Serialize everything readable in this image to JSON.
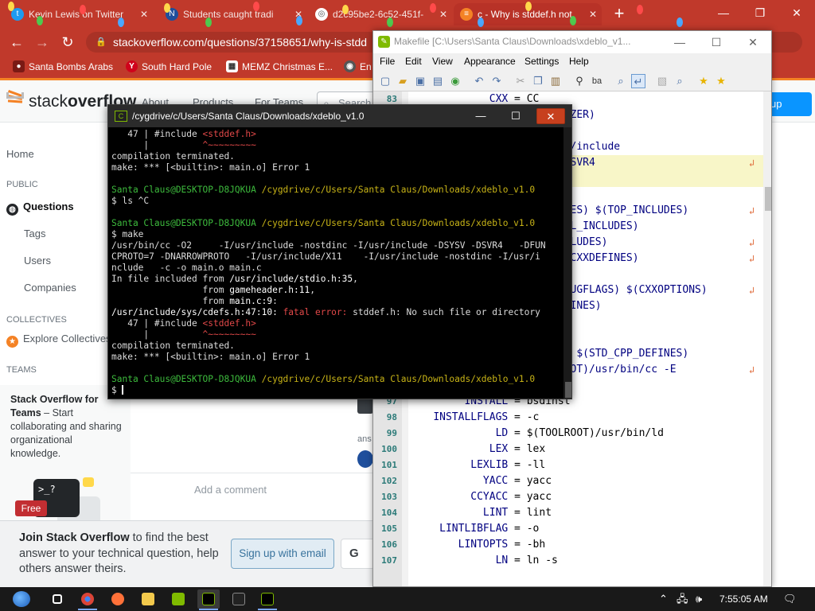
{
  "browser": {
    "tabs": [
      {
        "label": "Kevin Lewis on Twitter"
      },
      {
        "label": "Students caught tradi"
      },
      {
        "label": "d2c95be2-6c52-451f-"
      },
      {
        "label": "c - Why is stddef.h not"
      }
    ],
    "address": "stackoverflow.com/questions/37158651/why-is-stdd",
    "bookmarks": [
      {
        "label": "Santa Bombs Arabs"
      },
      {
        "label": "South Hard Pole"
      },
      {
        "label": "MEMZ Christmas E..."
      },
      {
        "label": "En"
      }
    ]
  },
  "so": {
    "logo_light": "stack",
    "logo_bold": "overflow",
    "nav": [
      "About",
      "Products",
      "For Teams"
    ],
    "search_placeholder": "Search",
    "signup": "up",
    "left_nav": {
      "home": "Home",
      "public": "PUBLIC",
      "questions": "Questions",
      "tags": "Tags",
      "users": "Users",
      "companies": "Companies",
      "collectives": "COLLECTIVES",
      "explore": "Explore Collectives",
      "teams": "TEAMS"
    },
    "teams_box": {
      "title": "Stack Overflow for Teams",
      "dash": " – ",
      "text": "Start collaborating and sharing organizational knowledge.",
      "badge": "Free",
      "art": ">_?"
    },
    "answer_label": "ans",
    "add_comment": "Add a comment",
    "join_bold": "Join Stack Overflow",
    "join_text": " to find the best answer to your technical question, help others answer theirs.",
    "signup_email": "Sign up with email",
    "signup_google": "G"
  },
  "npp": {
    "title": "Makefile [C:\\Users\\Santa Claus\\Downloads\\xdeblo_v1...",
    "menu": [
      "File",
      "Edit",
      "View",
      "Appearance",
      "Settings",
      "Help"
    ],
    "lines": [
      {
        "n": "83",
        "name": "CXX",
        "val": "CC",
        "hl": false,
        "wrap": false
      },
      {
        "n": "",
        "name": "",
        "val": "MIZER)",
        "hl": false,
        "wrap": false
      },
      {
        "n": "",
        "name": "",
        "val": "",
        "hl": false,
        "wrap": false
      },
      {
        "n": "",
        "name": "",
        "val": "P)/include",
        "hl": false,
        "wrap": false
      },
      {
        "n": "",
        "name": "",
        "val": "-DSVR4",
        "hl": true,
        "wrap": true
      },
      {
        "n": "",
        "name": "",
        "val": "",
        "hl": true,
        "wrap": false
      },
      {
        "n": "",
        "name": "",
        "val": "",
        "hl": false,
        "wrap": false
      },
      {
        "n": "",
        "name": "",
        "val": "UDES) $(TOP_INCLUDES)",
        "hl": false,
        "wrap": true
      },
      {
        "n": "",
        "name": "",
        "val": "IDL_INCLUDES)",
        "hl": false,
        "wrap": false
      },
      {
        "n": "",
        "name": "",
        "val": "NCLUDES)",
        "hl": false,
        "wrap": true
      },
      {
        "n": "",
        "name": "",
        "val": "S_CXXDEFINES)",
        "hl": false,
        "wrap": true
      },
      {
        "n": "",
        "name": "",
        "val": "",
        "hl": false,
        "wrap": false
      },
      {
        "n": "",
        "name": "",
        "val": "EBUGFLAGS) $(CXXOPTIONS)",
        "hl": false,
        "wrap": true
      },
      {
        "n": "",
        "name": "",
        "val": "EFINES)",
        "hl": false,
        "wrap": false
      },
      {
        "n": "",
        "name": "",
        "val": "",
        "hl": false,
        "wrap": false
      },
      {
        "n": "",
        "name": "",
        "val": "ss",
        "hl": false,
        "wrap": false
      },
      {
        "n": "",
        "name": "",
        "val": "pp $(STD_CPP_DEFINES)",
        "hl": false,
        "wrap": false
      },
      {
        "n": "",
        "name": "",
        "val": "ROOT)/usr/bin/cc -E",
        "hl": false,
        "wrap": true
      },
      {
        "n": "",
        "name": "",
        "val": "$(STD_CPP_DEFINES)",
        "hl": false,
        "wrap": false
      },
      {
        "n": "97",
        "name": "INSTALL",
        "val": "bsdinst",
        "hl": false,
        "wrap": false
      },
      {
        "n": "98",
        "name": "INSTALLFLAGS",
        "val": "-c",
        "hl": false,
        "wrap": false
      },
      {
        "n": "99",
        "name": "LD",
        "val": "$(TOOLROOT)/usr/bin/ld",
        "hl": false,
        "wrap": false
      },
      {
        "n": "100",
        "name": "LEX",
        "val": "lex",
        "hl": false,
        "wrap": false
      },
      {
        "n": "101",
        "name": "LEXLIB",
        "val": "-ll",
        "hl": false,
        "wrap": false
      },
      {
        "n": "102",
        "name": "YACC",
        "val": "yacc",
        "hl": false,
        "wrap": false
      },
      {
        "n": "103",
        "name": "CCYACC",
        "val": "yacc",
        "hl": false,
        "wrap": false
      },
      {
        "n": "104",
        "name": "LINT",
        "val": "lint",
        "hl": false,
        "wrap": false
      },
      {
        "n": "105",
        "name": "LINTLIBFLAG",
        "val": "-o",
        "hl": false,
        "wrap": false
      },
      {
        "n": "106",
        "name": "LINTOPTS",
        "val": "-bh",
        "hl": false,
        "wrap": false
      },
      {
        "n": "107",
        "name": "LN",
        "val": "ln -s",
        "hl": false,
        "wrap": false
      }
    ]
  },
  "term": {
    "title": "/cygdrive/c/Users/Santa Claus/Downloads/xdeblo_v1.0",
    "lines": [
      [
        {
          "t": "   47 | #include "
        },
        {
          "t": "<stddef.h>",
          "c": "c-red"
        }
      ],
      [
        {
          "t": "      |          "
        },
        {
          "t": "^~~~~~~~~~",
          "c": "c-red"
        }
      ],
      [
        {
          "t": "compilation terminated."
        }
      ],
      [
        {
          "t": "make: *** [<builtin>: main.o] Error 1"
        }
      ],
      [
        {
          "t": ""
        }
      ],
      [
        {
          "t": "Santa Claus@DESKTOP-D8JQKUA",
          "c": "c-green"
        },
        {
          "t": " "
        },
        {
          "t": "/cygdrive/c/Users/Santa Claus/Downloads/xdeblo_v1.0",
          "c": "c-yellow"
        }
      ],
      [
        {
          "t": "$ ls ^C"
        }
      ],
      [
        {
          "t": ""
        }
      ],
      [
        {
          "t": "Santa Claus@DESKTOP-D8JQKUA",
          "c": "c-green"
        },
        {
          "t": " "
        },
        {
          "t": "/cygdrive/c/Users/Santa Claus/Downloads/xdeblo_v1.0",
          "c": "c-yellow"
        }
      ],
      [
        {
          "t": "$ make"
        }
      ],
      [
        {
          "t": "/usr/bin/cc -O2     -I/usr/include -nostdinc -I/usr/include -DSYSV -DSVR4   -DFUN"
        }
      ],
      [
        {
          "t": "CPROTO=7 -DNARROWPROTO   -I/usr/include/X11    -I/usr/include -nostdinc -I/usr/i"
        }
      ],
      [
        {
          "t": "nclude   -c -o main.o main.c"
        }
      ],
      [
        {
          "t": "In file included from "
        },
        {
          "t": "/usr/include/stdio.h:35",
          "c": "c-bold"
        },
        {
          "t": ","
        }
      ],
      [
        {
          "t": "                 from "
        },
        {
          "t": "gameheader.h:11",
          "c": "c-bold"
        },
        {
          "t": ","
        }
      ],
      [
        {
          "t": "                 from "
        },
        {
          "t": "main.c:9",
          "c": "c-bold"
        },
        {
          "t": ":"
        }
      ],
      [
        {
          "t": "/usr/include/sys/cdefs.h:47:10:",
          "c": "c-bold"
        },
        {
          "t": " "
        },
        {
          "t": "fatal error: ",
          "c": "c-red"
        },
        {
          "t": "stddef.h: No such file or directory"
        }
      ],
      [
        {
          "t": "   47 | #include "
        },
        {
          "t": "<stddef.h>",
          "c": "c-red"
        }
      ],
      [
        {
          "t": "      |          "
        },
        {
          "t": "^~~~~~~~~~",
          "c": "c-red"
        }
      ],
      [
        {
          "t": "compilation terminated."
        }
      ],
      [
        {
          "t": "make: *** [<builtin>: main.o] Error 1"
        }
      ],
      [
        {
          "t": ""
        }
      ],
      [
        {
          "t": "Santa Claus@DESKTOP-D8JQKUA",
          "c": "c-green"
        },
        {
          "t": " "
        },
        {
          "t": "/cygdrive/c/Users/Santa Claus/Downloads/xdeblo_v1.0",
          "c": "c-yellow"
        }
      ],
      [
        {
          "t": "$ "
        }
      ]
    ]
  },
  "taskbar": {
    "clock": "7:55:05 AM"
  }
}
